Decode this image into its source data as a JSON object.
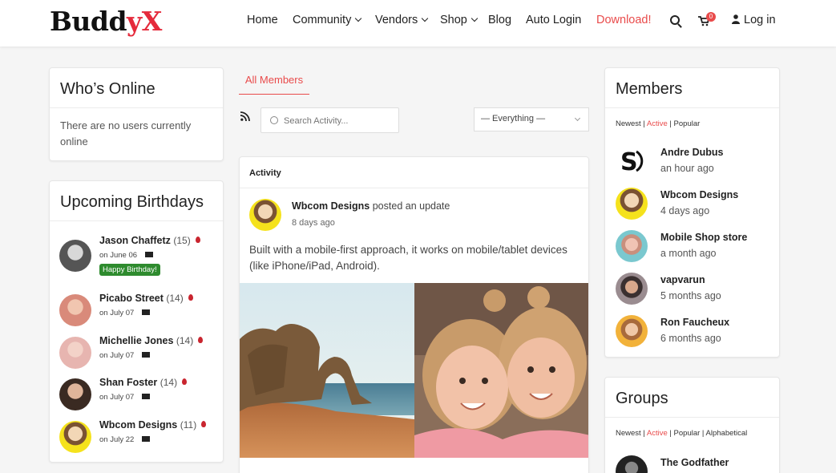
{
  "brand": {
    "name_main": "Budd",
    "name_accent": "yX"
  },
  "nav": {
    "home": "Home",
    "community": "Community",
    "vendors": "Vendors",
    "shop": "Shop",
    "blog": "Blog",
    "auto_login": "Auto Login",
    "download": "Download!",
    "cart_count": "0",
    "login": "Log in"
  },
  "whos_online": {
    "title": "Who’s Online",
    "message": "There are no users currently online"
  },
  "birthdays": {
    "title": "Upcoming Birthdays",
    "happy_label": "Happy Birthday!",
    "items": [
      {
        "name": "Jason Chaffetz",
        "age": "(15)",
        "date": "on June 06"
      },
      {
        "name": "Picabo Street",
        "age": "(14)",
        "date": "on July 07"
      },
      {
        "name": "Michellie Jones",
        "age": "(14)",
        "date": "on July 07"
      },
      {
        "name": "Shan Foster",
        "age": "(14)",
        "date": "on July 07"
      },
      {
        "name": "Wbcom Designs",
        "age": "(11)",
        "date": "on July 22"
      }
    ]
  },
  "activity": {
    "tab": "All Members",
    "search_placeholder": "Search Activity...",
    "filter_value": "— Everything —",
    "header": "Activity",
    "post": {
      "author": "Wbcom Designs",
      "action": "posted an update",
      "time": "8 days ago",
      "text": "Built with a mobile-first approach, it works on mobile/tablet devices (like iPhone/iPad, Android)."
    }
  },
  "members": {
    "title": "Members",
    "filter": {
      "newest": "Newest",
      "active": "Active",
      "popular": "Popular"
    },
    "items": [
      {
        "name": "Andre Dubus",
        "time": "an hour ago"
      },
      {
        "name": "Wbcom Designs",
        "time": "4 days ago"
      },
      {
        "name": "Mobile Shop store",
        "time": "a month ago"
      },
      {
        "name": "vapvarun",
        "time": "5 months ago"
      },
      {
        "name": "Ron Faucheux",
        "time": "6 months ago"
      }
    ]
  },
  "groups": {
    "title": "Groups",
    "filter": {
      "newest": "Newest",
      "active": "Active",
      "popular": "Popular",
      "alphabetical": "Alphabetical"
    },
    "items": [
      {
        "name": "The Godfather"
      }
    ]
  },
  "colors": {
    "accent": "#e94b4b",
    "happy_badge": "#2e8b2e",
    "brand_x": "#e52a3b"
  }
}
